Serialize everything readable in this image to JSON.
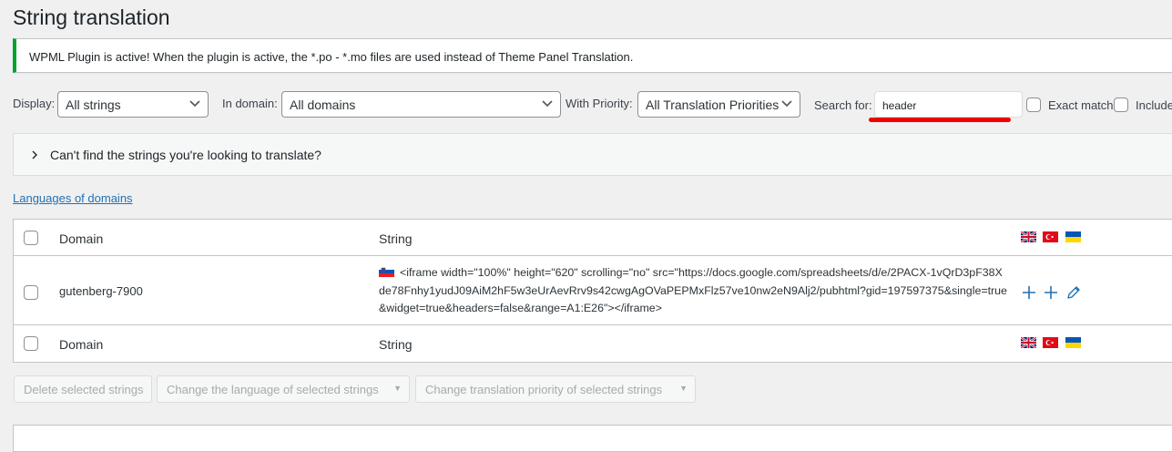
{
  "page_title": "String translation",
  "notice": "WPML Plugin is active! When the plugin is active, the *.po - *.mo files are used instead of Theme Panel Translation.",
  "filters": {
    "display_label": "Display:",
    "display_value": "All strings",
    "domain_label": "In domain:",
    "domain_value": "All domains",
    "priority_label": "With Priority:",
    "priority_value": "All Translation Priorities",
    "search_label": "Search for:",
    "search_value": "header",
    "exact_match_label": "Exact match",
    "include_label": "Include"
  },
  "accordion_text": "Can't find the strings you're looking to translate?",
  "languages_link": "Languages of domains",
  "table": {
    "header_domain": "Domain",
    "header_string": "String",
    "row": {
      "domain": "gutenberg-7900",
      "string": "<iframe width=\"100%\" height=\"620\" scrolling=\"no\" src=\"https://docs.google.com/spreadsheets/d/e/2PACX-1vQrD3pF38Xde78Fnhy1yudJ09AiM2hF5w3eUrAevRrv9s42cwgAgOVaPEPMxFlz57ve10nw2eN9Alj2/pubhtml?gid=197597375&single=true&widget=true&headers=false&range=A1:E26\"></iframe>"
    },
    "footer_domain": "Domain",
    "footer_string": "String",
    "flags": [
      "uk-flag-icon",
      "turkey-flag-icon",
      "ukraine-flag-icon"
    ]
  },
  "actions": {
    "delete_label": "Delete selected strings",
    "change_language_label": "Change the language of selected strings",
    "change_priority_label": "Change translation priority of selected strings"
  },
  "colors": {
    "accent": "#2271b1",
    "success": "#00a32a",
    "highlight": "#ee0000"
  }
}
